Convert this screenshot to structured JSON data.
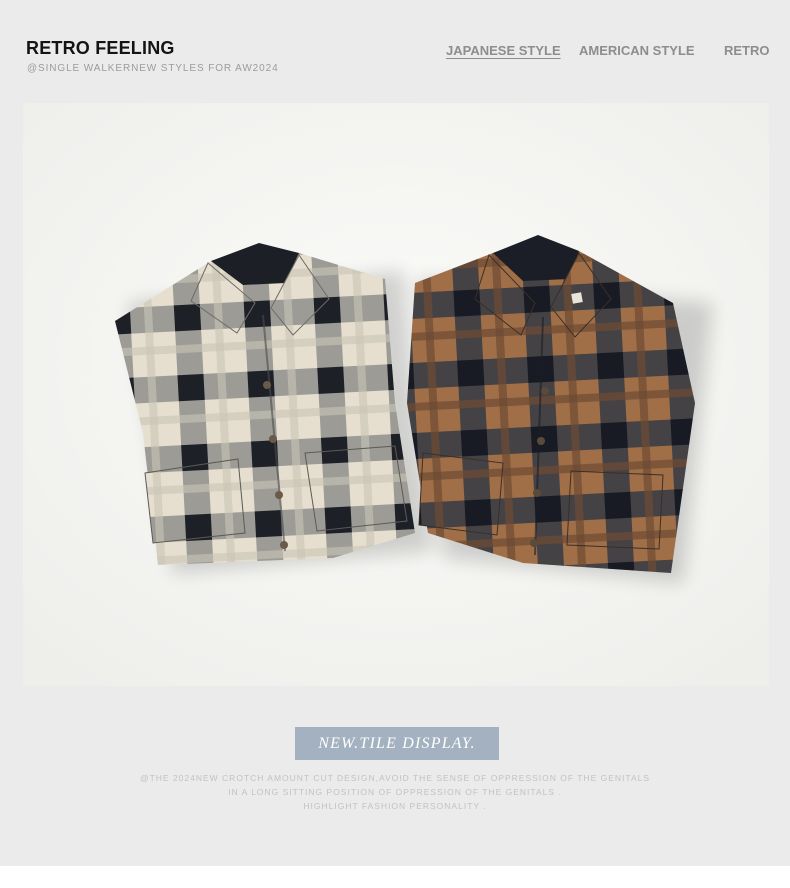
{
  "header": {
    "brand_title": "RETRO FEELING",
    "brand_subtitle": "@SINGLE WALKERNEW STYLES FOR AW2024"
  },
  "nav": {
    "items": [
      {
        "label": "JAPANESE STYLE",
        "active": true
      },
      {
        "label": "AMERICAN STYLE",
        "active": false
      },
      {
        "label": "RETRO",
        "active": false
      }
    ]
  },
  "hero": {
    "image": "two-folded-plaid-shirts",
    "shirts": [
      {
        "colorway": "black-cream-grey"
      },
      {
        "colorway": "brown-navy"
      }
    ]
  },
  "footer": {
    "badge_label": "NEW.TILE DISPLAY.",
    "description_lines": [
      "@THE 2024NEW CROTCH AMOUNT CUT DESIGN,AVOID THE SENSE OF OPPRESSION OF THE GENITALS",
      "IN A LONG SITTING POSITION OF OPPRESSION OF THE GENITALS .",
      "HIGHLIGHT FASHION PERSONALITY ."
    ]
  },
  "colors": {
    "page_background": "#ebebeb",
    "badge_background": "#a3b1c0",
    "title_text": "#141414",
    "muted_text": "#8d8d8d"
  }
}
